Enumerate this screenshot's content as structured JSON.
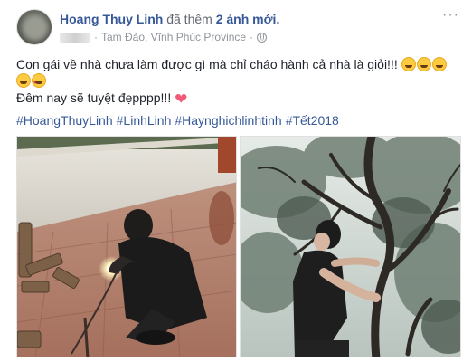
{
  "header": {
    "author": "Hoang Thuy Linh",
    "added_text": "đã thêm",
    "new_photos": "2 ảnh mới.",
    "location": "Tam Đảo, Vĩnh Phúc Province",
    "separator": "·",
    "more": "···"
  },
  "post": {
    "line1": "Con gái về nhà chưa làm được gì mà chỉ cháo hành cả nhà là giỏi!!!",
    "line3": "Đêm nay sẽ tuyệt đẹpppp!!!",
    "heart": "❤",
    "hashtags": [
      "#HoangThuyLinh",
      "#LinhLinh",
      "#Haynghichlinhtinh",
      "#Tết2018"
    ]
  },
  "colors": {
    "link": "#365899",
    "meta": "#90949c",
    "text": "#1d2129"
  },
  "icons": [
    "avatar-image",
    "globe-icon",
    "grin-emoji",
    "wink-emoji",
    "laugh-emoji",
    "squint-emoji",
    "heart-eyes-emoji",
    "red-heart-icon"
  ]
}
